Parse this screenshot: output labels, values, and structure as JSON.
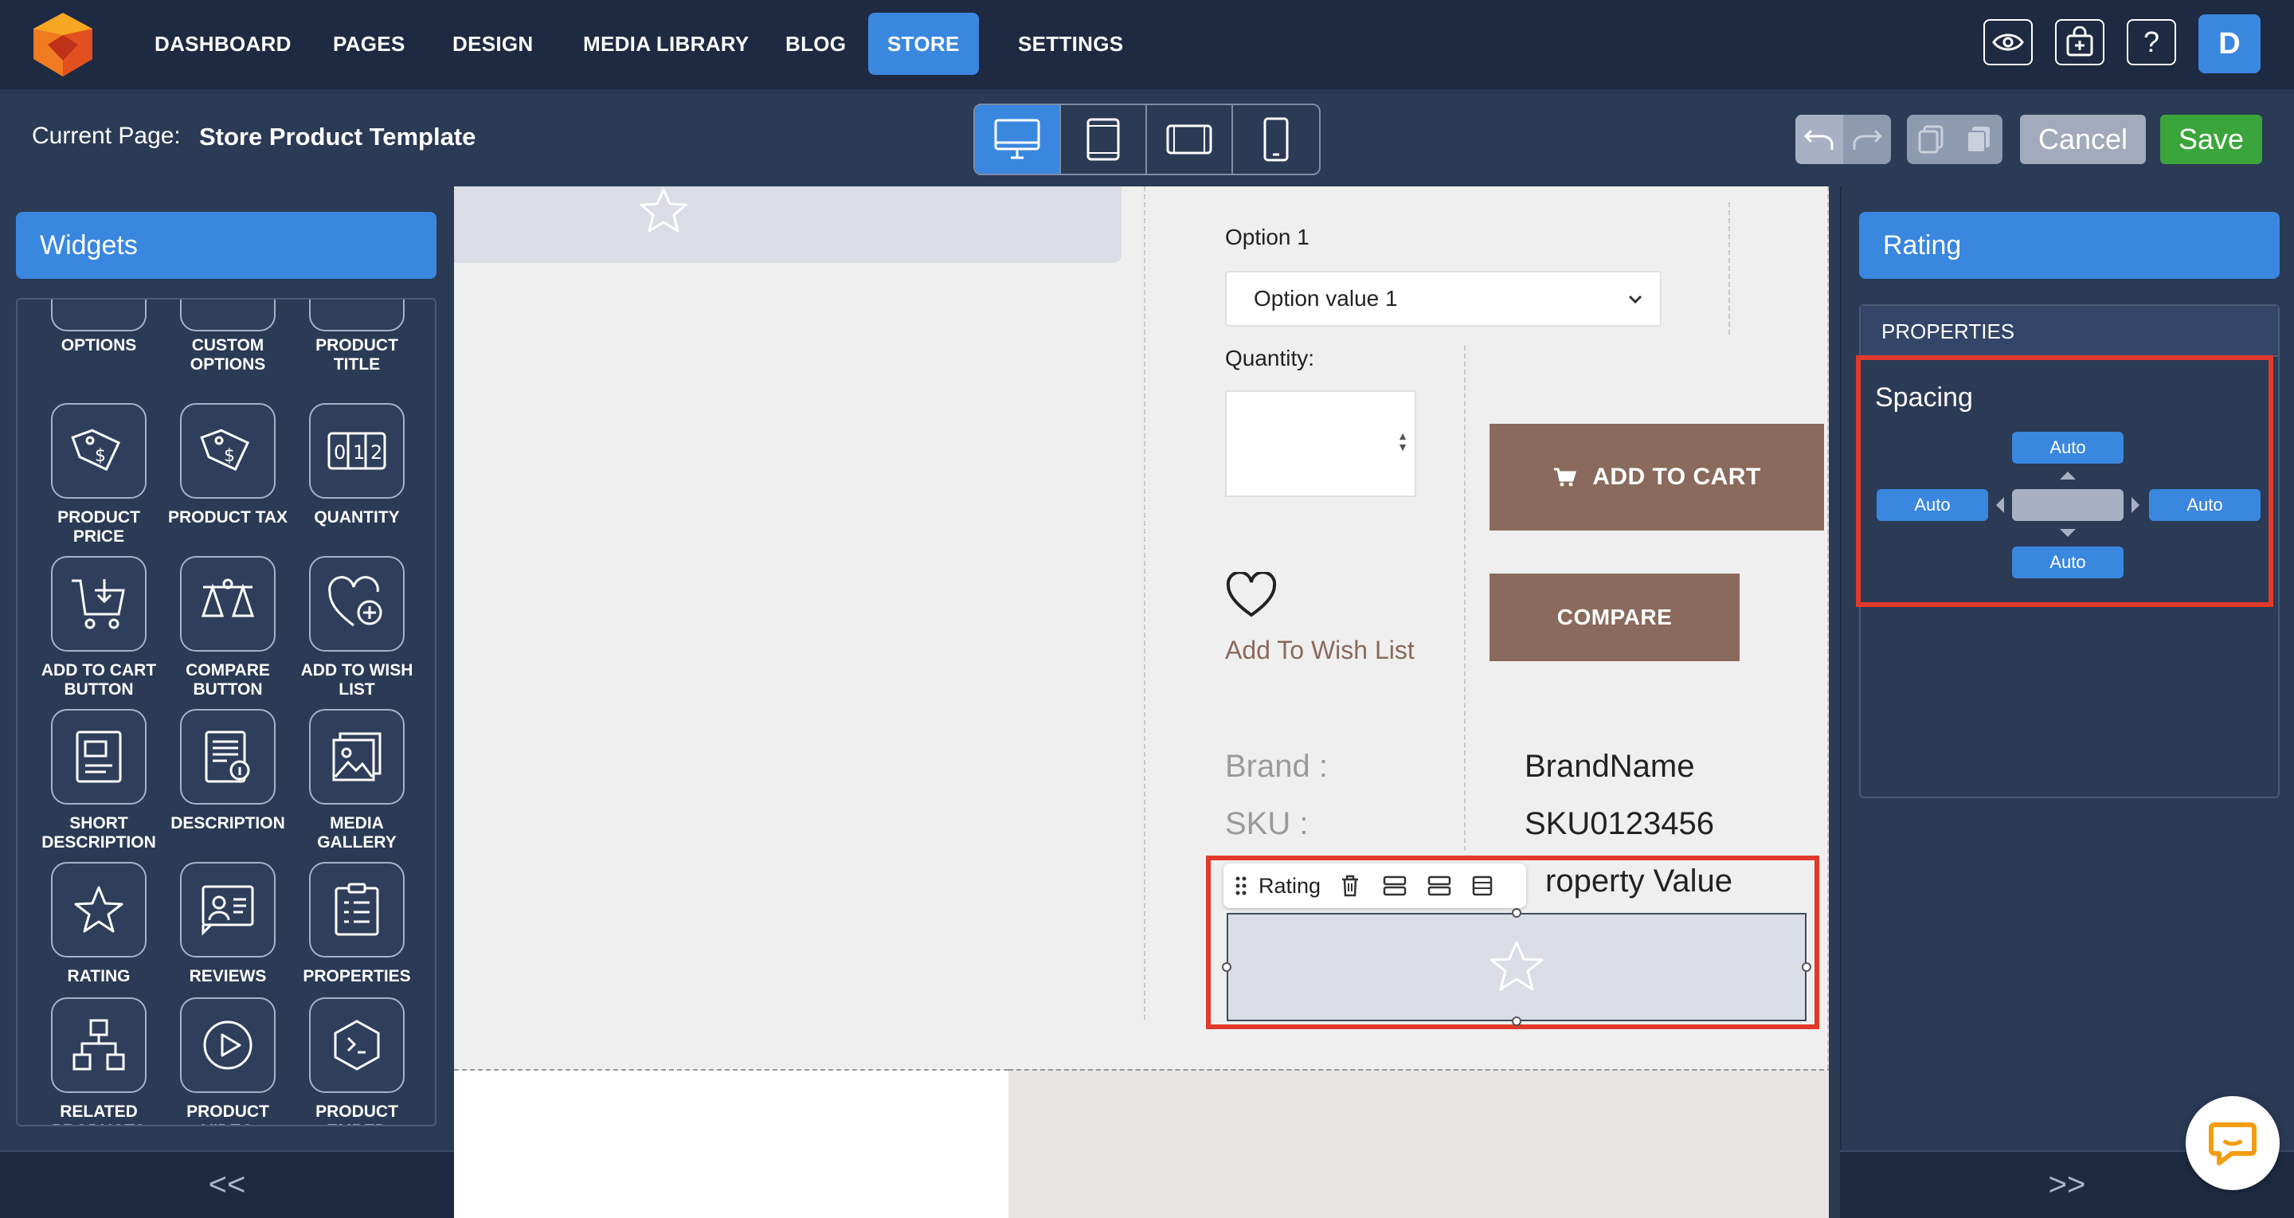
{
  "nav": {
    "items": [
      "DASHBOARD",
      "PAGES",
      "DESIGN",
      "MEDIA LIBRARY",
      "BLOG",
      "STORE",
      "SETTINGS"
    ],
    "active": "STORE",
    "avatar": "D",
    "help": "?"
  },
  "subbar": {
    "current_label": "Current Page:",
    "current_value": "Store Product Template",
    "cancel": "Cancel",
    "save": "Save"
  },
  "widgets": {
    "title": "Widgets",
    "partial_top": [
      "OPTIONS",
      "CUSTOM OPTIONS",
      "PRODUCT TITLE"
    ],
    "items": [
      {
        "label": "PRODUCT PRICE",
        "icon": "price-tag-icon"
      },
      {
        "label": "PRODUCT TAX",
        "icon": "tax-tag-icon"
      },
      {
        "label": "QUANTITY",
        "icon": "quantity-counter-icon"
      },
      {
        "label": "ADD TO CART BUTTON",
        "icon": "cart-icon"
      },
      {
        "label": "COMPARE BUTTON",
        "icon": "scale-icon"
      },
      {
        "label": "ADD TO WISH LIST",
        "icon": "heart-plus-icon"
      },
      {
        "label": "SHORT DESCRIPTION",
        "icon": "short-description-icon"
      },
      {
        "label": "DESCRIPTION",
        "icon": "description-icon"
      },
      {
        "label": "MEDIA GALLERY",
        "icon": "gallery-icon"
      },
      {
        "label": "RATING",
        "icon": "star-icon"
      },
      {
        "label": "REVIEWS",
        "icon": "reviews-icon"
      },
      {
        "label": "PROPERTIES",
        "icon": "properties-icon"
      },
      {
        "label": "RELATED PRODUCTS",
        "icon": "related-products-icon"
      },
      {
        "label": "PRODUCT VIDEO",
        "icon": "play-icon"
      },
      {
        "label": "PRODUCT EMBED",
        "icon": "embed-code-icon"
      }
    ],
    "collapse": "<<"
  },
  "canvas": {
    "option_label": "Option 1",
    "option_value": "Option value 1",
    "quantity_label": "Quantity:",
    "add_to_cart": "ADD TO CART",
    "compare": "COMPARE",
    "wish": "Add To Wish List",
    "brand_label": "Brand :",
    "brand_value": "BrandName",
    "sku_label": "SKU :",
    "sku_value": "SKU0123456",
    "property_value": "roperty Value",
    "toolbar_label": "Rating"
  },
  "right": {
    "title": "Rating",
    "properties": "PROPERTIES",
    "spacing": "Spacing",
    "top": "Auto",
    "left": "Auto",
    "right": "Auto",
    "bottom": "Auto",
    "collapse": ">>"
  },
  "colors": {
    "accent": "#3a87e0",
    "save": "#3aa53a",
    "product_button": "#8a6a5c",
    "highlight": "#e03a2a"
  }
}
